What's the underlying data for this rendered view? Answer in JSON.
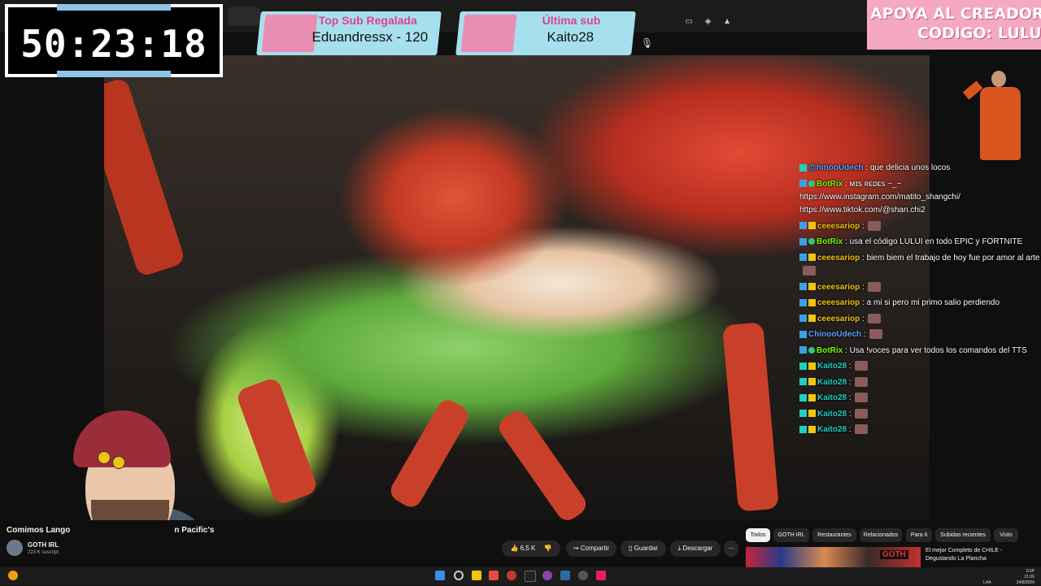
{
  "timer": {
    "value": "50:23:18"
  },
  "top_sub": {
    "title": "Top Sub Regalada",
    "value": "Eduandressx - 120"
  },
  "last_sub": {
    "title": "Última sub",
    "value": "Kaito28"
  },
  "promo": {
    "line1": "APOYA AL CREADOR",
    "line2": "CODIGO: LULUI"
  },
  "chat": [
    {
      "badges": [
        "tv"
      ],
      "user": "@hinooUdech",
      "user_color": "#5aa0ff",
      "text": ": que delicia unos locos"
    },
    {
      "badges": [
        "blue",
        "green"
      ],
      "user": "BotRix",
      "user_color": "#7cfc00",
      "text": ": ᴍɪs ʀᴇᴅᴇs ~_~ https://www.instagram.com/matito_shangchi/ https://www.tiktok.com/@shan.chi2",
      "wrap": true
    },
    {
      "badges": [
        "blue",
        "gold"
      ],
      "user": "ceeesariop",
      "user_color": "#f1c40f",
      "text": ":",
      "emote": true
    },
    {
      "badges": [
        "blue",
        "green"
      ],
      "user": "BotRix",
      "user_color": "#7cfc00",
      "text": ": usa el código LULUI en todo EPIC y FORTNITE"
    },
    {
      "badges": [
        "blue",
        "gold"
      ],
      "user": "ceeesariop",
      "user_color": "#f1c40f",
      "text": ": biem biem el trabajo de hoy fue por amor al arte",
      "wrap": true,
      "emote": true
    },
    {
      "badges": [
        "blue",
        "gold"
      ],
      "user": "ceeesariop",
      "user_color": "#f1c40f",
      "text": ":",
      "emote": true
    },
    {
      "badges": [
        "blue",
        "gold"
      ],
      "user": "ceeesariop",
      "user_color": "#f1c40f",
      "text": ": a mi si pero mi primo salio perdiendo"
    },
    {
      "badges": [
        "blue",
        "gold"
      ],
      "user": "ceeesariop",
      "user_color": "#f1c40f",
      "text": ":",
      "emote": true
    },
    {
      "badges": [
        "blue"
      ],
      "user": "ChinooUdech",
      "user_color": "#5aa0ff",
      "text": ":",
      "emote": true
    },
    {
      "badges": [
        "blue",
        "green"
      ],
      "user": "BotRix",
      "user_color": "#7cfc00",
      "text": ": Usa !voces para ver todos los comandos del TTS"
    },
    {
      "badges": [
        "tv",
        "gold"
      ],
      "user": "Kaito28",
      "user_color": "#1dd1c0",
      "text": ":",
      "emote": true
    },
    {
      "badges": [
        "tv",
        "gold"
      ],
      "user": "Kaito28",
      "user_color": "#1dd1c0",
      "text": ":",
      "emote": true
    },
    {
      "badges": [
        "tv",
        "gold"
      ],
      "user": "Kaito28",
      "user_color": "#1dd1c0",
      "text": ":",
      "emote": true
    },
    {
      "badges": [
        "tv",
        "gold"
      ],
      "user": "Kaito28",
      "user_color": "#1dd1c0",
      "text": ":",
      "emote": true
    },
    {
      "badges": [
        "tv",
        "gold"
      ],
      "user": "Kaito28",
      "user_color": "#1dd1c0",
      "text": ":",
      "emote": true
    }
  ],
  "video": {
    "title_left": "Comimos Lango",
    "title_right": "n Pacific's",
    "channel": "GOTH IRL",
    "subscribers": "223 K suscript"
  },
  "actions": {
    "likes": "6,5 K",
    "share": "Compartir",
    "save": "Guardar",
    "download": "Descargar",
    "more": "···"
  },
  "chips": [
    "Todos",
    "GOTH IRL",
    "Restaurantes",
    "Relacionados",
    "Para ti",
    "Subidas recientes",
    "Visto"
  ],
  "recommended": {
    "title": "El mejor Completo de CHILE - Degustando La Plancha",
    "thumb_badge": "GOTH"
  },
  "tray": {
    "lang1": "ESP",
    "lang2": "LAA",
    "time": "21:06",
    "date": "24/8/2026"
  },
  "icons": {
    "mic": "mic-icon",
    "like": "thumbs-up-icon",
    "dislike": "thumbs-down-icon",
    "share": "share-icon",
    "save": "bookmark-icon",
    "download": "download-icon"
  },
  "colors": {
    "sub_banner": "#a6e0ee",
    "sub_title": "#e0428a",
    "promo_bg": "#f4a8c4"
  }
}
